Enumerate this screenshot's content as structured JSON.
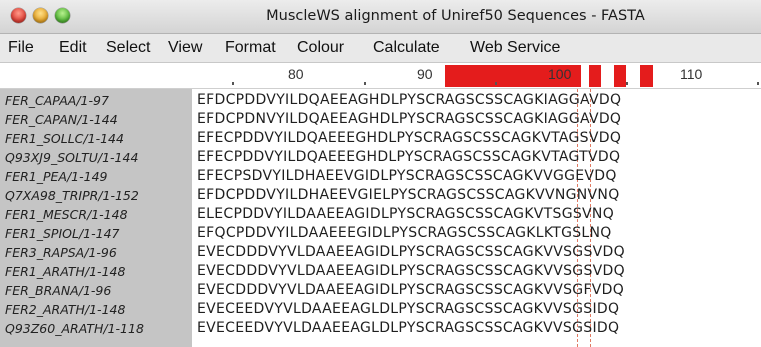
{
  "window": {
    "title": "MuscleWS alignment of Uniref50 Sequences - FASTA"
  },
  "menu": [
    "File",
    "Edit",
    "Select",
    "View",
    "Format",
    "Colour",
    "Calculate",
    "Web Service"
  ],
  "ruler": {
    "labels": [
      "80",
      "90",
      "100",
      "110"
    ]
  },
  "sequences": [
    {
      "name": "FER_CAPAA/1-97",
      "residues": "EFDCPDDVYILDQAEEAGHDLPYSCRAGSCSSCAGKIAGGAVDQ"
    },
    {
      "name": "FER_CAPAN/1-144",
      "residues": "EFDCPDNVYILDQAEEAGHDLPYSCRAGSCSSCAGKIAGGAVDQ"
    },
    {
      "name": "FER1_SOLLC/1-144",
      "residues": "EFECPDDVYILDQAEEEGHDLPYSCRAGSCSSCAGKVTAGSVDQ"
    },
    {
      "name": "Q93XJ9_SOLTU/1-144",
      "residues": "EFECPDDVYILDQAEEEGHDLPYSCRAGSCSSCAGKVTAGTVDQ"
    },
    {
      "name": "FER1_PEA/1-149",
      "residues": "EFECPSDVYILDHAEEVGIDLPYSCRAGSCSSCAGKVVGGEVDQ"
    },
    {
      "name": "Q7XA98_TRIPR/1-152",
      "residues": "EFDCPDDVYILDHAEEVGIELPYSCRAGSCSSCAGKVVNGNVNQ"
    },
    {
      "name": "FER1_MESCR/1-148",
      "residues": "ELECPDDVYILDAAEEAGIDLPYSCRAGSCSSCAGKVTSGSVNQ"
    },
    {
      "name": "FER1_SPIOL/1-147",
      "residues": "EFQCPDDVYILDAAEEEGIDLPYSCRAGSCSSCAGKLKTGSLNQ"
    },
    {
      "name": "FER3_RAPSA/1-96",
      "residues": "EVECDDDVYVLDAAEEAGIDLPYSCRAGSCSSCAGKVVSGSVDQ"
    },
    {
      "name": "FER1_ARATH/1-148",
      "residues": "EVECDDDVYVLDAAEEAGIDLPYSCRAGSCSSCAGKVVSGSVDQ"
    },
    {
      "name": "FER_BRANA/1-96",
      "residues": "EVECDDDVYVLDAAEEAGIDLPYSCRAGSCSSCAGKVVSGFVDQ"
    },
    {
      "name": "FER2_ARATH/1-148",
      "residues": "EVECEEDVYVLDAAEEAGLDLPYSCRAGSCSSCAGKVVSGSIDQ"
    },
    {
      "name": "Q93Z60_ARATH/1-118",
      "residues": "EVECEEDVYVLDAAEEAGLDLPYSCRAGSCSSCAGKVVSGSIDQ"
    }
  ],
  "colors": {
    "annotation_bar": "#e41c1c",
    "name_panel": "#c5c5c5",
    "column_marker": "#e07a62"
  }
}
